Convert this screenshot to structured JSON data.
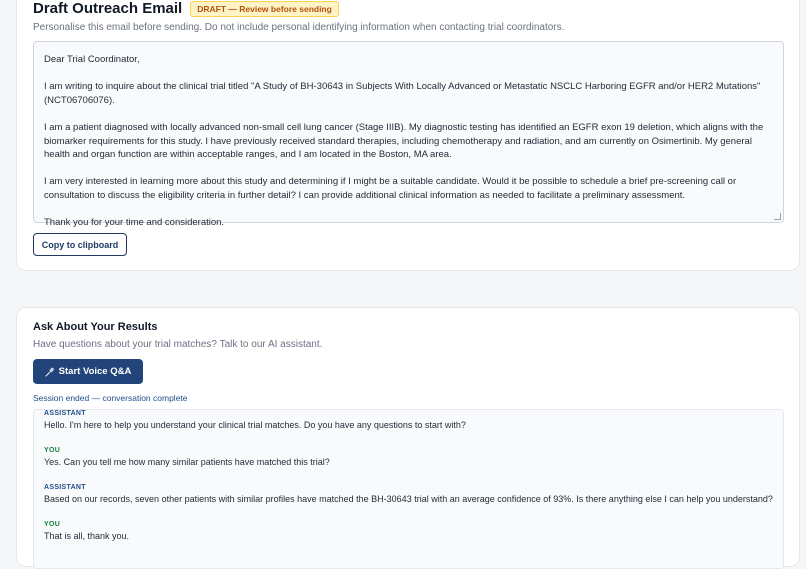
{
  "draft": {
    "title": "Draft Outreach Email",
    "badge": "DRAFT — Review before sending",
    "subtitle": "Personalise this email before sending. Do not include personal identifying information when contacting trial coordinators.",
    "email_paragraphs": [
      "Dear Trial Coordinator,",
      "I am writing to inquire about the clinical trial titled \"A Study of BH-30643 in Subjects With Locally Advanced or Metastatic NSCLC Harboring EGFR and/or HER2 Mutations\" (NCT06706076).",
      "I am a patient diagnosed with locally advanced non-small cell lung cancer (Stage IIIB). My diagnostic testing has identified an EGFR exon 19 deletion, which aligns with the biomarker requirements for this study. I have previously received standard therapies, including chemotherapy and radiation, and am currently on Osimertinib. My general health and organ function are within acceptable ranges, and I am located in the Boston, MA area.",
      "I am very interested in learning more about this study and determining if I might be a suitable candidate. Would it be possible to schedule a brief pre-screening call or consultation to discuss the eligibility criteria in further detail? I can provide additional clinical information as needed to facilitate a preliminary assessment.",
      "Thank you for your time and consideration."
    ],
    "copy_button": "Copy to clipboard"
  },
  "ask": {
    "title": "Ask About Your Results",
    "subtitle": "Have questions about your trial matches? Talk to our AI assistant.",
    "voice_button": "Start Voice Q&A",
    "voice_icon": "microphone-icon",
    "session_status": "Session ended — conversation complete",
    "messages": [
      {
        "role": "ASSISTANT",
        "text": "Hello. I'm here to help you understand your clinical trial matches. Do you have any questions to start with?"
      },
      {
        "role": "YOU",
        "text": "Yes. Can you tell me how many similar patients have matched this trial?"
      },
      {
        "role": "ASSISTANT",
        "text": "Based on our records, seven other patients with similar profiles have matched the BH-30643 trial with an average confidence of 93%. Is there anything else I can help you understand?"
      },
      {
        "role": "YOU",
        "text": "That is all, thank you."
      }
    ]
  },
  "colors": {
    "primary": "#23447a",
    "badge_bg": "#fef3c7",
    "badge_text": "#b45309",
    "assistant_label": "#1f4e8c",
    "user_label": "#15803d"
  }
}
